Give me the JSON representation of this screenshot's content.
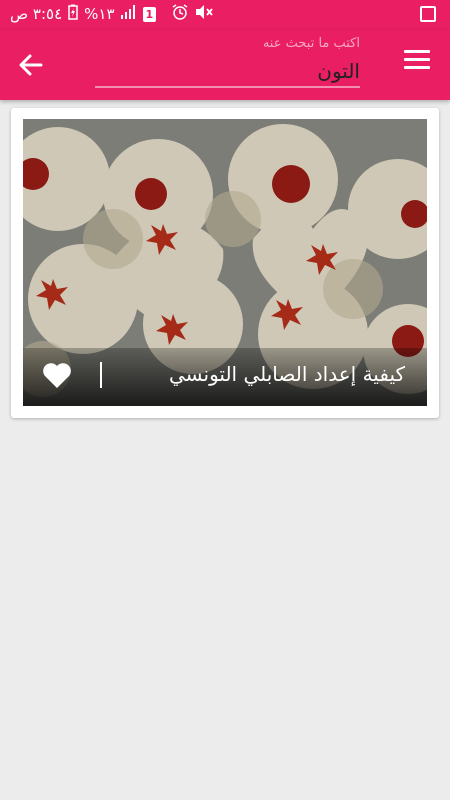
{
  "status_bar": {
    "time": "٣:٥٤ ص",
    "battery": "%١٣",
    "sim": "1"
  },
  "toolbar": {
    "back_icon": "arrow-back-icon",
    "menu_icon": "menu-icon",
    "search": {
      "placeholder": "اكتب ما تبحث عنه",
      "value": "التون"
    }
  },
  "results": [
    {
      "title": "كيفية إعداد الصابلي التونسي",
      "favorite_icon": "heart-icon"
    }
  ]
}
